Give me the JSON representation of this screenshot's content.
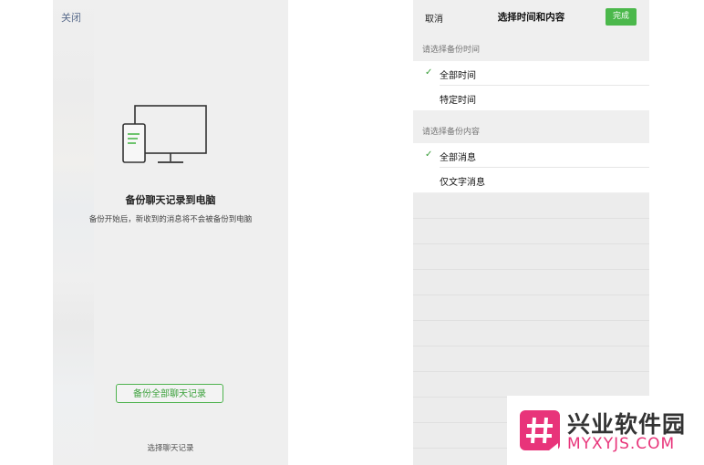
{
  "left_screen": {
    "close_label": "关闭",
    "title": "备份聊天记录到电脑",
    "description": "备份开始后，新收到的消息将不会被备份到电脑",
    "backup_all_button": "备份全部聊天记录",
    "select_chat_link": "选择聊天记录",
    "device_icon": "phone-computer-icon"
  },
  "right_screen": {
    "nav": {
      "cancel_label": "取消",
      "title": "选择时间和内容",
      "done_label": "完成"
    },
    "time_section": {
      "header": "请选择备份时间",
      "options": [
        {
          "label": "全部时间",
          "selected": true
        },
        {
          "label": "特定时间",
          "selected": false
        }
      ]
    },
    "content_section": {
      "header": "请选择备份内容",
      "options": [
        {
          "label": "全部消息",
          "selected": true
        },
        {
          "label": "仅文字消息",
          "selected": false
        }
      ]
    },
    "check_glyph": "✓"
  },
  "watermark": {
    "brand_cn": "兴业软件园",
    "brand_en": "MYXYJS.COM",
    "logo_icon": "hash-logo-icon"
  },
  "colors": {
    "accent_green": "#4bb84b",
    "watermark_pink": "#e8347a"
  }
}
